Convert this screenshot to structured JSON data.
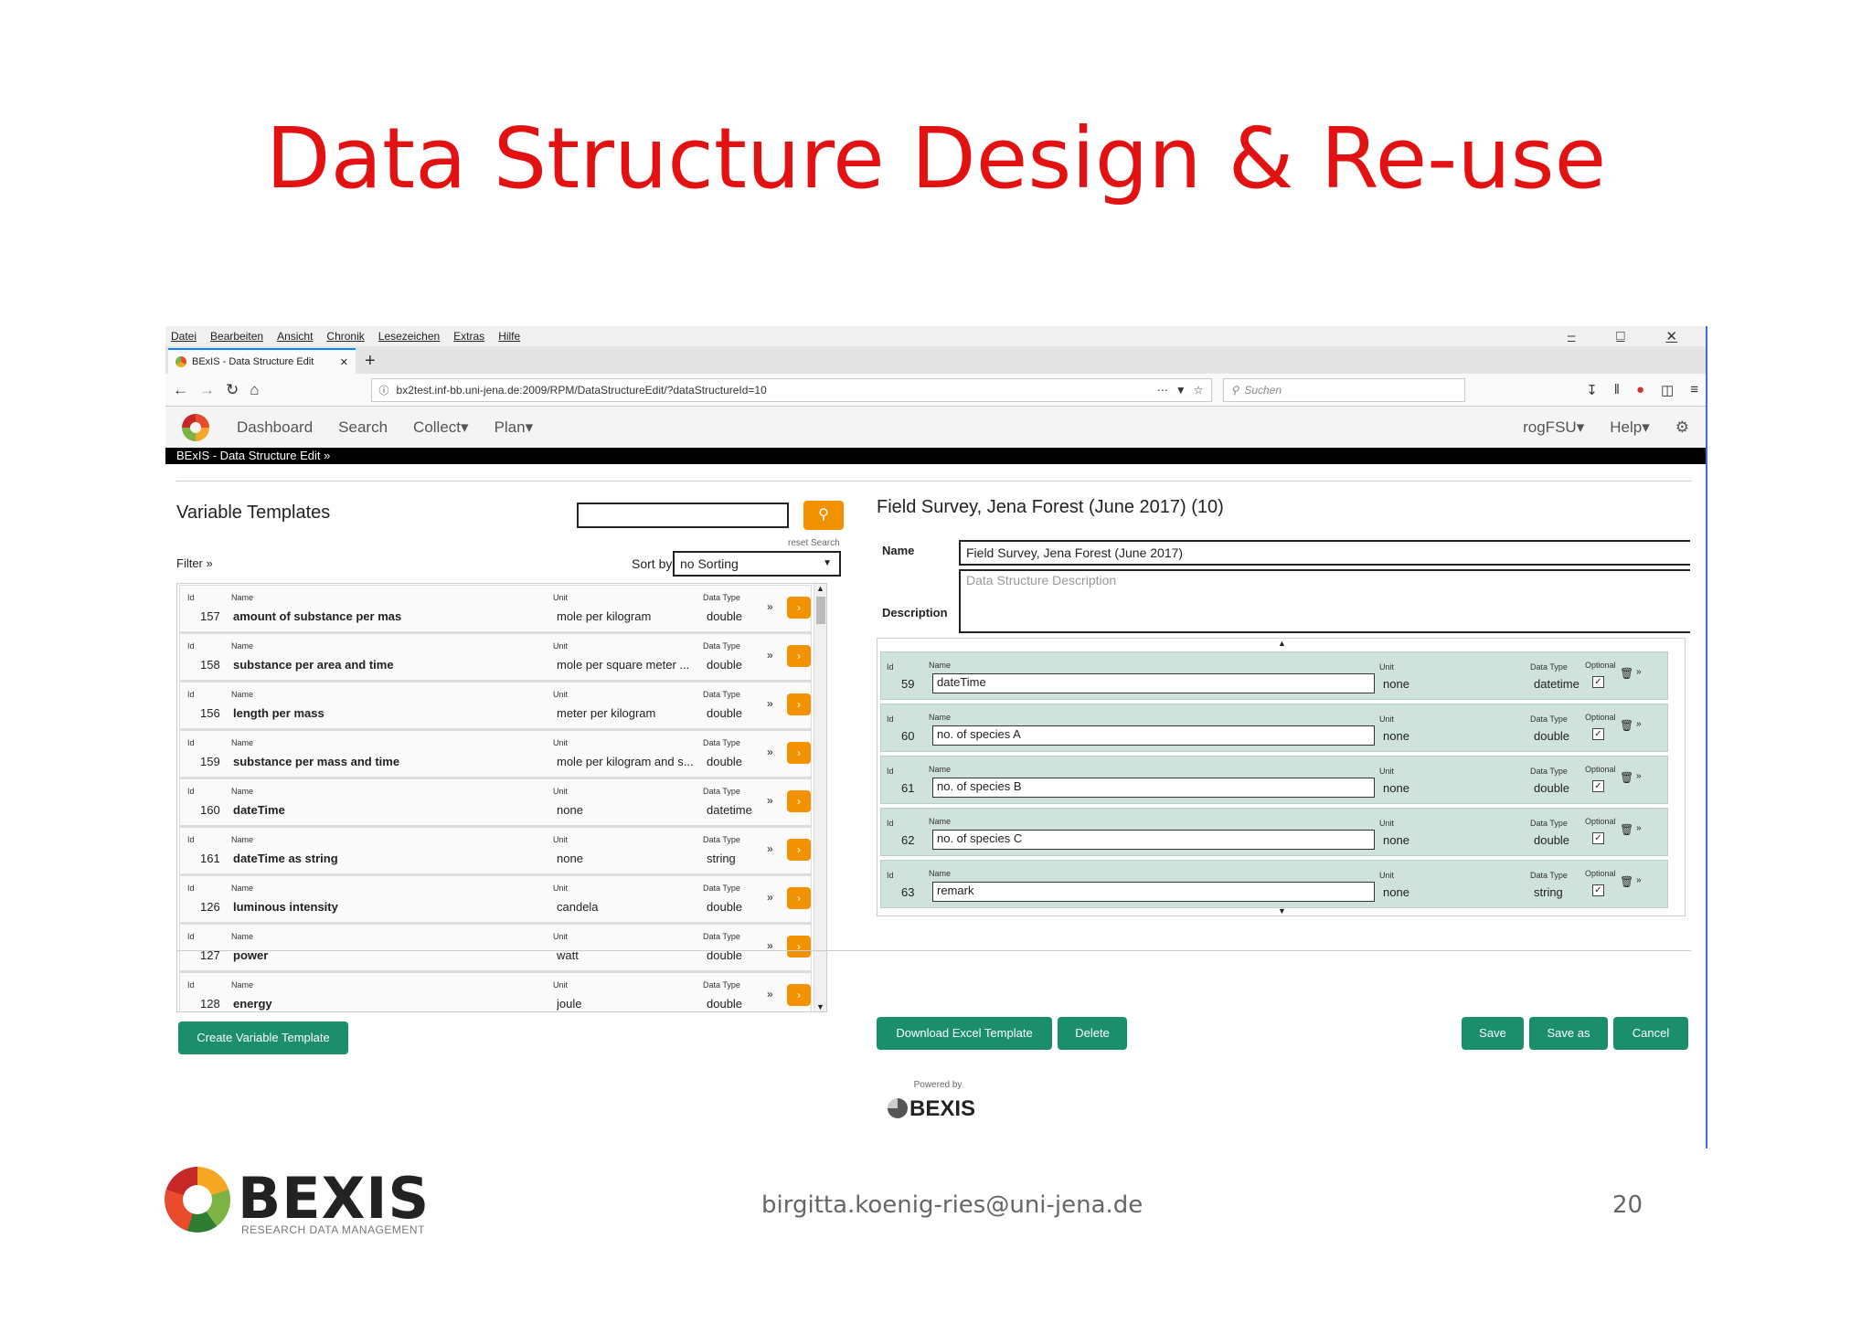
{
  "slide": {
    "title": "Data Structure Design & Re-use",
    "email": "birgitta.koenig-ries@uni-jena.de",
    "page_number": "20",
    "logo_text": "BEXIS",
    "logo_subtitle": "RESEARCH DATA MANAGEMENT"
  },
  "browser": {
    "menu": [
      "Datei",
      "Bearbeiten",
      "Ansicht",
      "Chronik",
      "Lesezeichen",
      "Extras",
      "Hilfe"
    ],
    "tab_title": "BExIS - Data Structure Edit",
    "url": "bx2test.inf-bb.uni-jena.de:2009/RPM/DataStructureEdit/?dataStructureId=10",
    "search_placeholder": "Suchen"
  },
  "app": {
    "nav": [
      "Dashboard",
      "Search",
      "Collect",
      "Plan"
    ],
    "user": "rogFSU",
    "help": "Help",
    "breadcrumb": "BExIS - Data Structure Edit »"
  },
  "left": {
    "title": "Variable Templates",
    "reset_search": "reset Search",
    "filter": "Filter »",
    "sort_by": "Sort by",
    "sort_value": "no Sorting",
    "labels": {
      "id": "Id",
      "name": "Name",
      "unit": "Unit",
      "datatype": "Data Type"
    },
    "templates": [
      {
        "id": "157",
        "name": "amount of substance per mas",
        "unit": "mole per kilogram",
        "datatype": "double"
      },
      {
        "id": "158",
        "name": "substance per area and time",
        "unit": "mole per square meter ...",
        "datatype": "double"
      },
      {
        "id": "156",
        "name": "length per mass",
        "unit": "meter per kilogram",
        "datatype": "double"
      },
      {
        "id": "159",
        "name": "substance per mass and time",
        "unit": "mole per kilogram and s...",
        "datatype": "double"
      },
      {
        "id": "160",
        "name": "dateTime",
        "unit": "none",
        "datatype": "datetime"
      },
      {
        "id": "161",
        "name": "dateTime as string",
        "unit": "none",
        "datatype": "string"
      },
      {
        "id": "126",
        "name": "luminous intensity",
        "unit": "candela",
        "datatype": "double"
      },
      {
        "id": "127",
        "name": "power",
        "unit": "watt",
        "datatype": "double"
      },
      {
        "id": "128",
        "name": "energy",
        "unit": "joule",
        "datatype": "double"
      }
    ],
    "create_button": "Create Variable Template"
  },
  "right": {
    "title": "Field Survey, Jena Forest (June 2017) (10)",
    "name_label": "Name",
    "name_value": "Field Survey, Jena Forest (June 2017)",
    "description_label": "Description",
    "description_placeholder": "Data Structure Description",
    "labels": {
      "id": "Id",
      "name": "Name",
      "unit": "Unit",
      "datatype": "Data Type",
      "optional": "Optional"
    },
    "variables": [
      {
        "id": "59",
        "name": "dateTime",
        "unit": "none",
        "datatype": "datetime"
      },
      {
        "id": "60",
        "name": "no. of species A",
        "unit": "none",
        "datatype": "double"
      },
      {
        "id": "61",
        "name": "no. of species B",
        "unit": "none",
        "datatype": "double"
      },
      {
        "id": "62",
        "name": "no. of species C",
        "unit": "none",
        "datatype": "double"
      },
      {
        "id": "63",
        "name": "remark",
        "unit": "none",
        "datatype": "string"
      }
    ],
    "buttons": {
      "download": "Download Excel Template",
      "delete": "Delete",
      "save": "Save",
      "save_as": "Save as",
      "cancel": "Cancel"
    }
  },
  "powered": {
    "label": "Powered by",
    "logo": "BEXIS"
  }
}
